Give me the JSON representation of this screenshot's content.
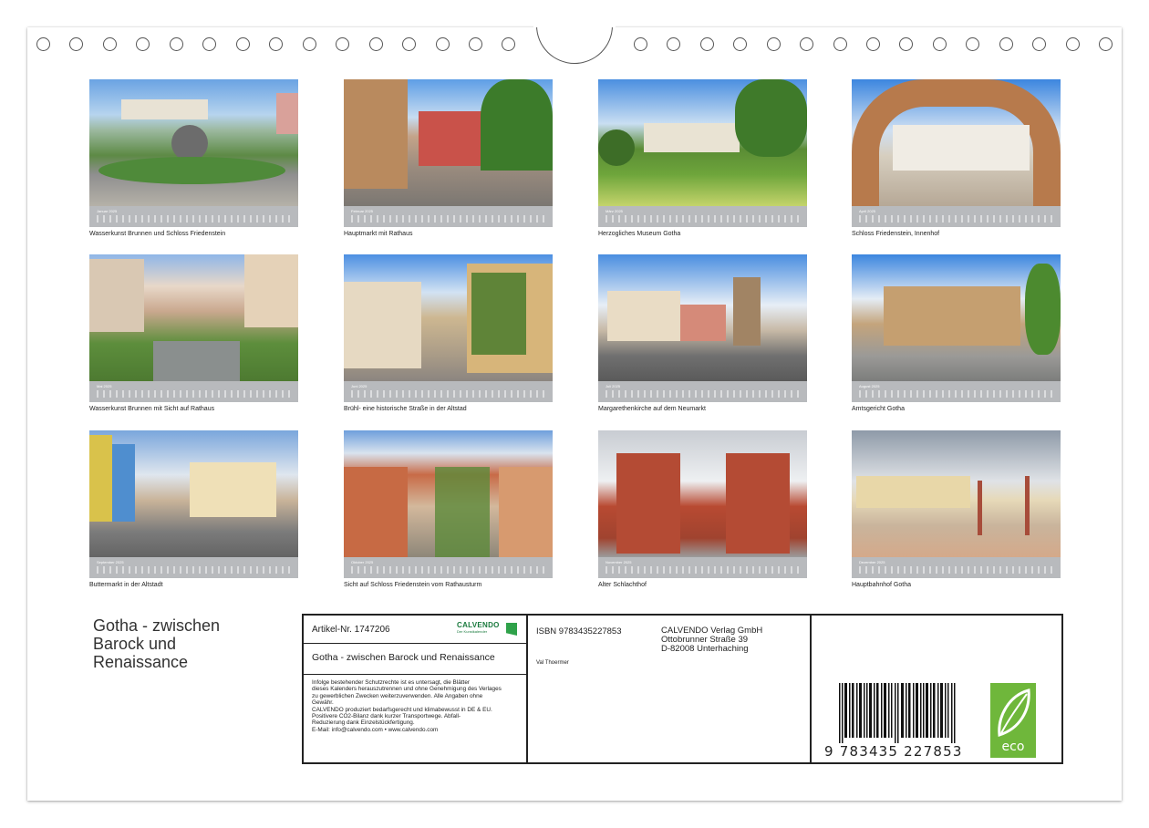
{
  "tiles": [
    {
      "month": "Januar 2025",
      "caption": "Wasserkunst Brunnen und Schloss Friedenstein"
    },
    {
      "month": "Februar 2025",
      "caption": "Hauptmarkt mit Rathaus"
    },
    {
      "month": "März 2025",
      "caption": "Herzogliches Museum Gotha"
    },
    {
      "month": "April 2025",
      "caption": "Schloss Friedenstein, Innenhof"
    },
    {
      "month": "Mai 2025",
      "caption": "Wasserkunst Brunnen mit Sicht auf Rathaus"
    },
    {
      "month": "Juni 2025",
      "caption": "Brühl- eine historische Straße in der Altstad"
    },
    {
      "month": "Juli 2025",
      "caption": "Margarethenkirche auf dem Neumarkt"
    },
    {
      "month": "August 2025",
      "caption": "Amtsgericht Gotha"
    },
    {
      "month": "September 2025",
      "caption": "Buttermarkt in der Altstadt"
    },
    {
      "month": "Oktober 2025",
      "caption": "Sicht auf Schloss Friedenstein vom Rathausturm"
    },
    {
      "month": "November 2025",
      "caption": "Alter Schlachthof"
    },
    {
      "month": "Dezember 2025",
      "caption": "Hauptbahnhof Gotha"
    }
  ],
  "cover_title": {
    "line1": "Gotha - zwischen",
    "line2": "Barock und",
    "line3": "Renaissance"
  },
  "info": {
    "article": "Artikel-Nr. 1747206",
    "brand_name": "CALVENDO",
    "brand_tagline": "Der Kunstkalender",
    "subtitle": "Gotha - zwischen Barock und Renaissance",
    "legal": [
      "Infolge bestehender Schutzrechte ist es untersagt, die Blätter",
      "dieses Kalenders herauszutrennen und ohne Genehmigung des Verlages",
      "zu gewerblichen Zwecken weiterzuverwenden. Alle Angaben ohne",
      "Gewähr.",
      "CALVENDO produziert bedarfsgerecht und klimabewusst in DE & EU.",
      "Positivere CO2-Bilanz dank kurzer Transportwege. Abfall-",
      "Reduzierung dank Einzelstückfertigung.",
      "E-Mail: info@calvendo.com • www.calvendo.com"
    ],
    "isbn": "ISBN 9783435227853",
    "publisher": [
      "CALVENDO Verlag GmbH",
      "Ottobrunner Straße 39",
      "D-82008 Unterhaching"
    ],
    "author": "Val Thoermer",
    "barcode_number": "9 783435 227853",
    "eco_label": "eco"
  },
  "colors": {
    "calendar_bar": "#b8babd",
    "eco_green": "#6fb73b",
    "brand_green": "#1a7a3e"
  }
}
